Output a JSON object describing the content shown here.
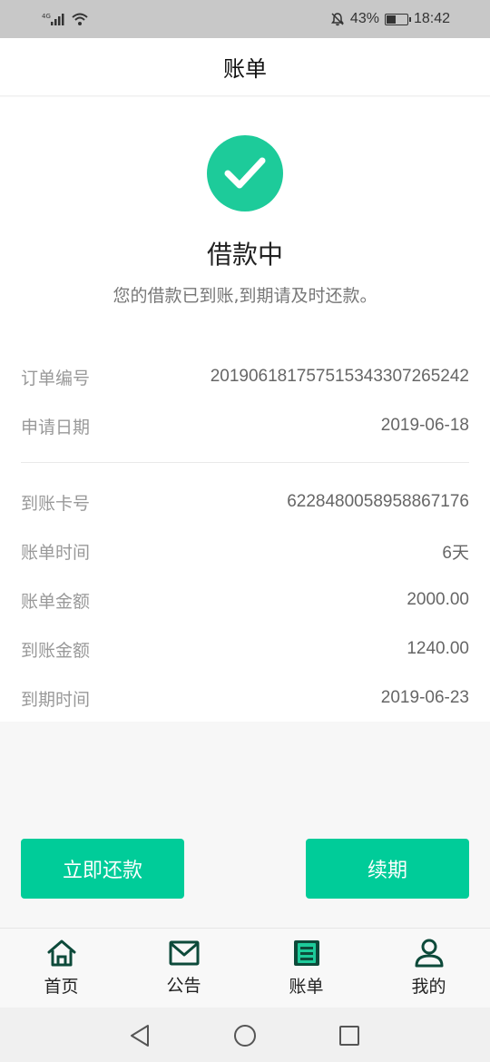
{
  "status_bar": {
    "network": "4G",
    "battery": "43%",
    "battery_level": 0.43,
    "time": "18:42"
  },
  "header": {
    "title": "账单"
  },
  "status": {
    "title": "借款中",
    "subtitle": "您的借款已到账,到期请及时还款。",
    "accent_color": "#1dcb9a"
  },
  "details": {
    "order_no_label": "订单编号",
    "order_no": "20190618175751534330726524​2",
    "apply_date_label": "申请日期",
    "apply_date": "2019-06-18",
    "card_no_label": "到账卡号",
    "card_no": "6228480058958867176",
    "bill_time_label": "账单时间",
    "bill_time": "6天",
    "bill_amount_label": "账单金额",
    "bill_amount": "2000.00",
    "received_amount_label": "到账金额",
    "received_amount": "1240.00",
    "due_date_label": "到期时间",
    "due_date": "2019-06-23"
  },
  "actions": {
    "repay_label": "立即还款",
    "renew_label": "续期",
    "button_color": "#00cc99"
  },
  "tabs": [
    {
      "label": "首页",
      "icon": "home-icon"
    },
    {
      "label": "公告",
      "icon": "mail-icon"
    },
    {
      "label": "账单",
      "icon": "bill-icon",
      "active": true
    },
    {
      "label": "我的",
      "icon": "user-icon"
    }
  ],
  "icon_color": "#0d4a3a"
}
